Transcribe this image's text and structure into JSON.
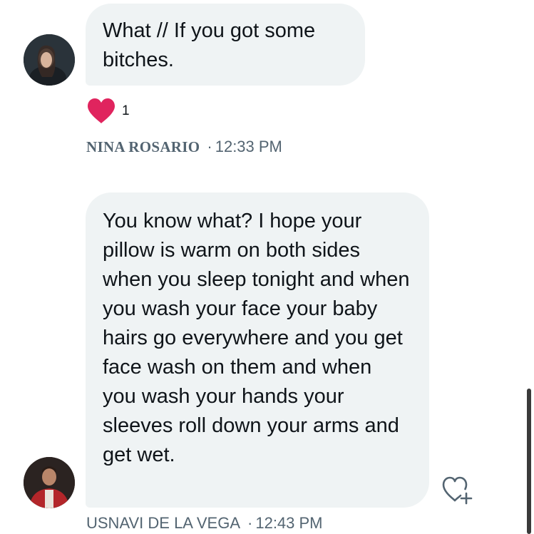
{
  "messages": [
    {
      "text": "What // If you got some bitches.",
      "reaction_count": "1",
      "sender": "NINA ROSARIO",
      "separator": "·",
      "time": "12:33 PM",
      "avatar_caption": "NINA ROSARIO"
    },
    {
      "text": "You know what? I hope your pillow is warm on both sides when you sleep tonight and when you wash your face your baby hairs go everywhere and you get face wash on them and when you wash your hands your sleeves roll down your arms and get wet.",
      "sender": "USNAVI DE LA VEGA",
      "separator": "·",
      "time": "12:43 PM"
    }
  ],
  "icons": {
    "reaction": "heart-icon",
    "add_reaction": "heart-plus-icon"
  },
  "colors": {
    "bubble": "#eff3f4",
    "heart": "#e0245e",
    "meta": "#536471",
    "text": "#0f1419"
  }
}
